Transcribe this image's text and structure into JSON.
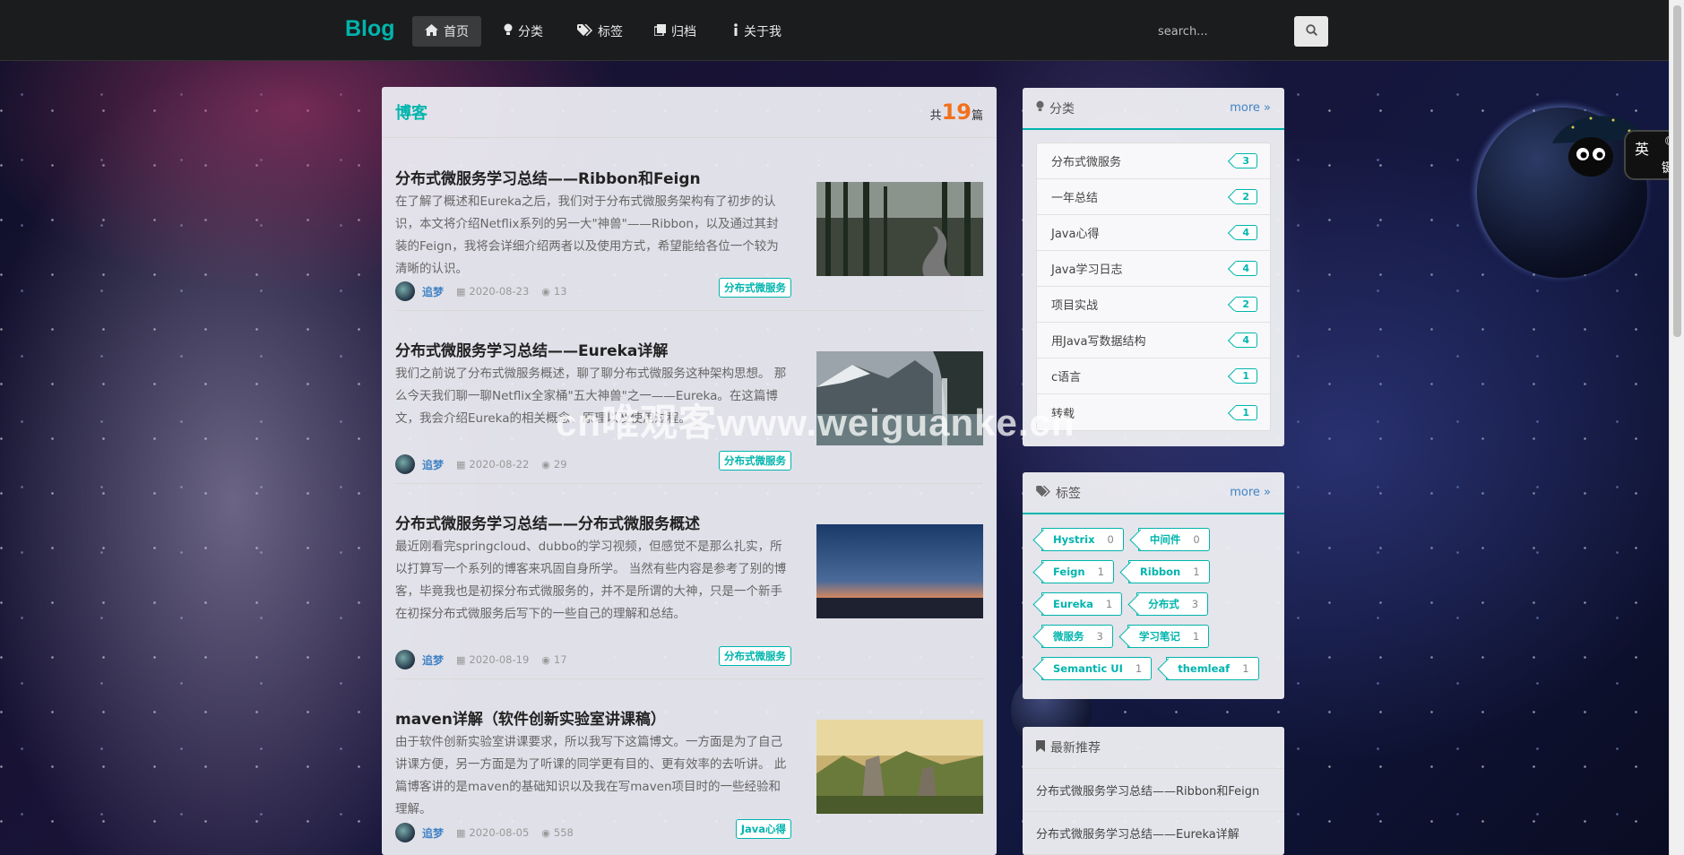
{
  "nav": {
    "brand": "Blog",
    "items": [
      {
        "label": "首页",
        "icon": "home-icon",
        "active": true
      },
      {
        "label": "分类",
        "icon": "idea-icon"
      },
      {
        "label": "标签",
        "icon": "tags-icon"
      },
      {
        "label": "归档",
        "icon": "clone-icon"
      },
      {
        "label": "关于我",
        "icon": "info-icon"
      }
    ],
    "search_placeholder": "search...",
    "search_icon": "search-icon"
  },
  "main": {
    "title": "博客",
    "count_prefix": "共",
    "count": "19",
    "count_suffix": "篇",
    "posts": [
      {
        "title": "分布式微服务学习总结——Ribbon和Feign",
        "summary": "在了解了概述和Eureka之后，我们对于分布式微服务架构有了初步的认识，本文将介绍Netflix系列的另一大\"神兽\"——Ribbon，以及通过其封装的Feign，我将会详细介绍两者以及使用方式，希望能给各位一个较为清晰的认识。",
        "author": "追梦",
        "date": "2020-08-23",
        "views": "13",
        "tag": "分布式微服务",
        "thumb": "forest-road"
      },
      {
        "title": "分布式微服务学习总结——Eureka详解",
        "summary": "我们之前说了分布式微服务概述，聊了聊分布式微服务这种架构思想。 那么今天我们聊一聊Netflix全家桶\"五大神兽\"之一——Eureka。在这篇博文，我会介绍Eureka的相关概念、原理以及使用过程。",
        "author": "追梦",
        "date": "2020-08-22",
        "views": "29",
        "tag": "分布式微服务",
        "thumb": "fjord-waterfall"
      },
      {
        "title": "分布式微服务学习总结——分布式微服务概述",
        "summary": "最近刚看完springcloud、dubbo的学习视频，但感觉不是那么扎实，所以打算写一个系列的博客来巩固自身所学。 当然有些内容是参考了别的博客，毕竟我也是初探分布式微服务的，并不是所谓的大神，只是一个新手在初探分布式微服务后写下的一些自己的理解和总结。",
        "author": "追梦",
        "date": "2020-08-19",
        "views": "17",
        "tag": "分布式微服务",
        "thumb": "sea-sunset"
      },
      {
        "title": "maven详解（软件创新实验室讲课稿）",
        "summary": "由于软件创新实验室讲课要求，所以我写下这篇博文。一方面是为了自己讲课方便，另一方面是为了听课的同学更有目的、更有效率的去听讲。 此篇博客讲的是maven的基础知识以及我在写maven项目时的一些经验和理解。",
        "author": "追梦",
        "date": "2020-08-05",
        "views": "558",
        "tag": "Java心得",
        "thumb": "rock-landscape"
      }
    ]
  },
  "sidebar": {
    "categories": {
      "title": "分类",
      "more": "more",
      "items": [
        {
          "name": "分布式微服务",
          "count": "3"
        },
        {
          "name": "一年总结",
          "count": "2"
        },
        {
          "name": "Java心得",
          "count": "4"
        },
        {
          "name": "Java学习日志",
          "count": "4"
        },
        {
          "name": "项目实战",
          "count": "2"
        },
        {
          "name": "用Java写数据结构",
          "count": "4"
        },
        {
          "name": "c语言",
          "count": "1"
        },
        {
          "name": "转载",
          "count": "1"
        }
      ]
    },
    "tags": {
      "title": "标签",
      "more": "more",
      "items": [
        {
          "name": "Hystrix",
          "count": "0"
        },
        {
          "name": "中间件",
          "count": "0"
        },
        {
          "name": "Feign",
          "count": "1"
        },
        {
          "name": "Ribbon",
          "count": "1"
        },
        {
          "name": "Eureka",
          "count": "1"
        },
        {
          "name": "分布式",
          "count": "3"
        },
        {
          "name": "微服务",
          "count": "3"
        },
        {
          "name": "学习笔记",
          "count": "1"
        },
        {
          "name": "Semantic UI",
          "count": "1"
        },
        {
          "name": "themleaf",
          "count": "1"
        }
      ]
    },
    "recommend": {
      "title": "最新推荐",
      "items": [
        "分布式微服务学习总结——Ribbon和Feign",
        "分布式微服务学习总结——Eureka详解"
      ]
    }
  },
  "overlay": {
    "watermark": "cn唯观客www.weiguanke.cn",
    "ime_top": "英",
    "ime_bottom": "键"
  },
  "colors": {
    "accent": "#00b5ad",
    "count": "#f2711c",
    "link": "#4183c4"
  }
}
